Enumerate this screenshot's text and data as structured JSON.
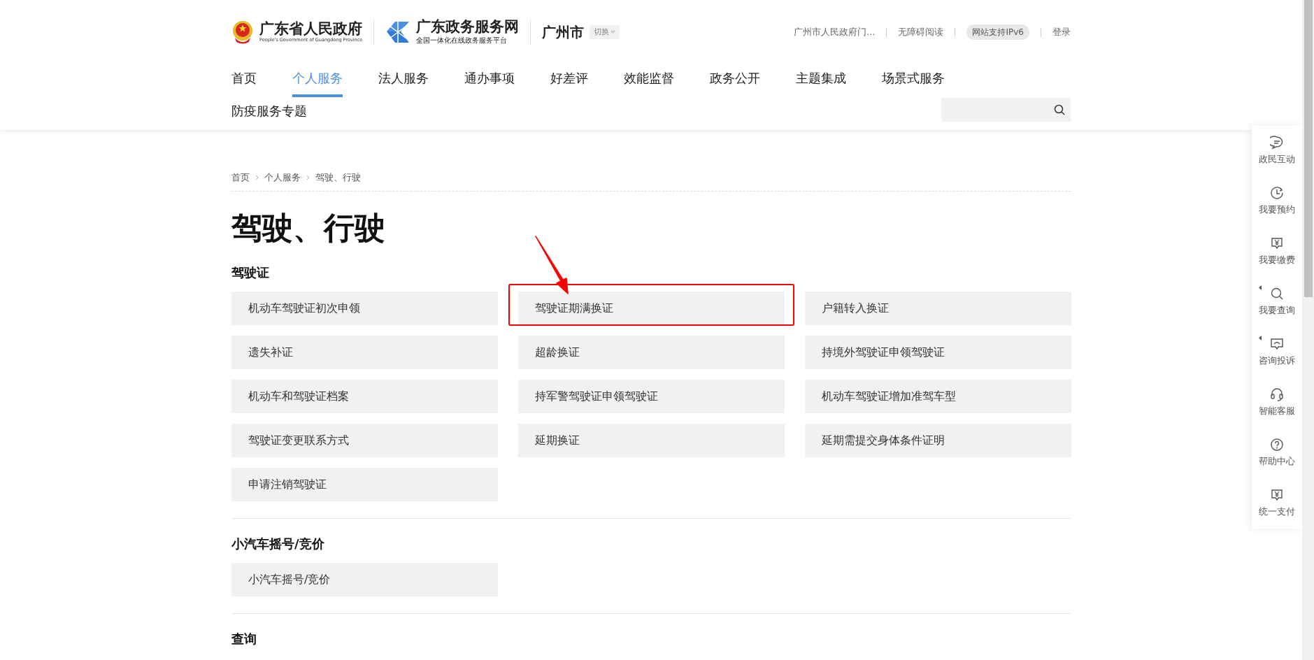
{
  "header": {
    "gov_name": "广东省人民政府",
    "gov_name_en": "People's Government of Guangdong Province",
    "portal_name": "广东政务服务网",
    "portal_slogan": "全国一体化在线政务服务平台",
    "city": "广州市",
    "switch_label": "切换",
    "top_links": [
      {
        "kind": "link",
        "label": "广州市人民政府门..."
      },
      {
        "kind": "link",
        "label": "无障碍阅读"
      },
      {
        "kind": "pill",
        "label": "网站支持IPv6"
      },
      {
        "kind": "link",
        "label": "登录"
      }
    ]
  },
  "nav": [
    {
      "label": "首页",
      "selected": false
    },
    {
      "label": "个人服务",
      "selected": true
    },
    {
      "label": "法人服务",
      "selected": false
    },
    {
      "label": "通办事项",
      "selected": false
    },
    {
      "label": "好差评",
      "selected": false
    },
    {
      "label": "效能监督",
      "selected": false
    },
    {
      "label": "政务公开",
      "selected": false
    },
    {
      "label": "主题集成",
      "selected": false
    },
    {
      "label": "场景式服务",
      "selected": false
    },
    {
      "label": "防疫服务专题",
      "selected": false
    }
  ],
  "breadcrumb": [
    "首页",
    "个人服务",
    "驾驶、行驶"
  ],
  "page_title": "驾驶、行驶",
  "sections": [
    {
      "title": "驾驶证",
      "items": [
        {
          "label": "机动车驾驶证初次申领",
          "annotated": false
        },
        {
          "label": "驾驶证期满换证",
          "annotated": true
        },
        {
          "label": "户籍转入换证",
          "annotated": false
        },
        {
          "label": "遗失补证",
          "annotated": false
        },
        {
          "label": "超龄换证",
          "annotated": false
        },
        {
          "label": "持境外驾驶证申领驾驶证",
          "annotated": false
        },
        {
          "label": "机动车和驾驶证档案",
          "annotated": false
        },
        {
          "label": "持军警驾驶证申领驾驶证",
          "annotated": false
        },
        {
          "label": "机动车驾驶证增加准驾车型",
          "annotated": false
        },
        {
          "label": "驾驶证变更联系方式",
          "annotated": false
        },
        {
          "label": "延期换证",
          "annotated": false
        },
        {
          "label": "延期需提交身体条件证明",
          "annotated": false
        },
        {
          "label": "申请注销驾驶证",
          "annotated": false
        }
      ]
    },
    {
      "title": "小汽车摇号/竞价",
      "items": [
        {
          "label": "小汽车摇号/竞价",
          "annotated": false
        }
      ]
    },
    {
      "title": "查询"
    }
  ],
  "side_tools": [
    {
      "kind": "chat",
      "label": "政民互动",
      "has_submenu": false
    },
    {
      "kind": "clock",
      "label": "我要预约",
      "has_submenu": false
    },
    {
      "kind": "yen",
      "label": "我要缴费",
      "has_submenu": false
    },
    {
      "kind": "search",
      "label": "我要查询",
      "has_submenu": true
    },
    {
      "kind": "screen",
      "label": "咨询投诉",
      "has_submenu": true
    },
    {
      "kind": "headset",
      "label": "智能客服",
      "has_submenu": false
    },
    {
      "kind": "help",
      "label": "帮助中心",
      "has_submenu": false
    },
    {
      "kind": "yen",
      "label": "统一支付",
      "has_submenu": false
    }
  ]
}
